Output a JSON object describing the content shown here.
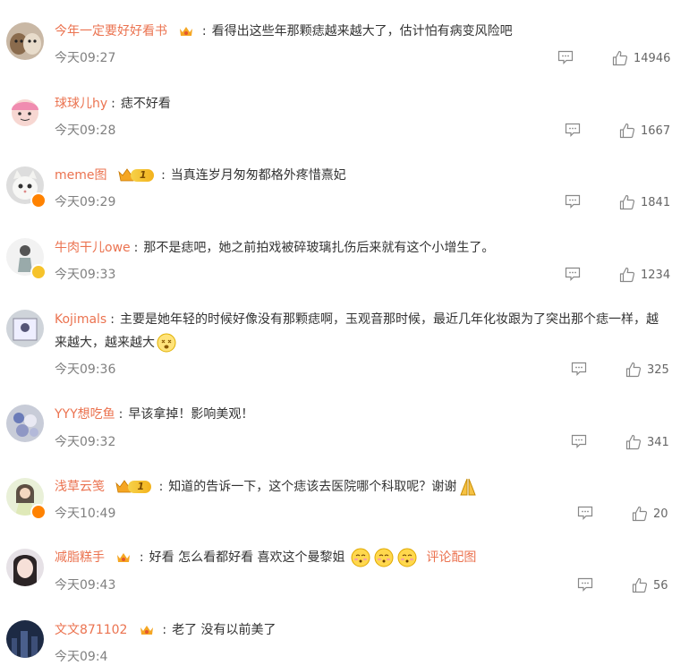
{
  "comments": [
    {
      "user": "今年一定要好好看书",
      "text": "看得出这些年那颗痣越来越大了，估计怕有病变风险吧",
      "time": "今天09:27",
      "likes": "14946",
      "badge": "vip-crown",
      "avatar": "cats"
    },
    {
      "user": "球球儿hy",
      "text": "痣不好看",
      "time": "今天09:28",
      "likes": "1667",
      "badge": "",
      "avatar": "pink-cartoon"
    },
    {
      "user": "meme图",
      "text": "当真连岁月匆匆都格外疼惜熹妃",
      "time": "今天09:29",
      "likes": "1841",
      "badge": "crown-1",
      "avatar": "white-cat"
    },
    {
      "user": "牛肉干儿owe",
      "text": "那不是痣吧，她之前拍戏被碎玻璃扎伤后来就有这个小增生了。",
      "time": "今天09:33",
      "likes": "1234",
      "badge": "",
      "avatar": "person"
    },
    {
      "user": "Kojimals",
      "text": "主要是她年轻的时候好像没有那颗痣啊，玉观音那时候，最近几年化妆跟为了突出那个痣一样，越来越大，越来越大",
      "time": "今天09:36",
      "likes": "325",
      "badge": "",
      "avatar": "cat-photo"
    },
    {
      "user": "YYY想吃鱼",
      "text": "早该拿掉！影响美观！",
      "time": "今天09:32",
      "likes": "341",
      "badge": "",
      "avatar": "flowers"
    },
    {
      "user": "浅草云笺",
      "text": "知道的告诉一下，这个痣该去医院哪个科取呢？谢谢",
      "time": "今天10:49",
      "likes": "20",
      "badge": "crown-1",
      "avatar": "girl"
    },
    {
      "user": "减脂糕手",
      "text": "好看 怎么看都好看 喜欢这个曼黎姐",
      "time": "今天09:43",
      "likes": "56",
      "badge": "vip-crown",
      "avatar": "face",
      "pic_link": "评论配图"
    },
    {
      "user": "文文871102",
      "text": "老了 没有以前美了",
      "time": "今天09:4",
      "likes": "",
      "badge": "vip-crown",
      "avatar": "night"
    }
  ],
  "crown_level": "1",
  "colors": {
    "username": "#eb7350",
    "time": "#808080",
    "text": "#333333"
  }
}
